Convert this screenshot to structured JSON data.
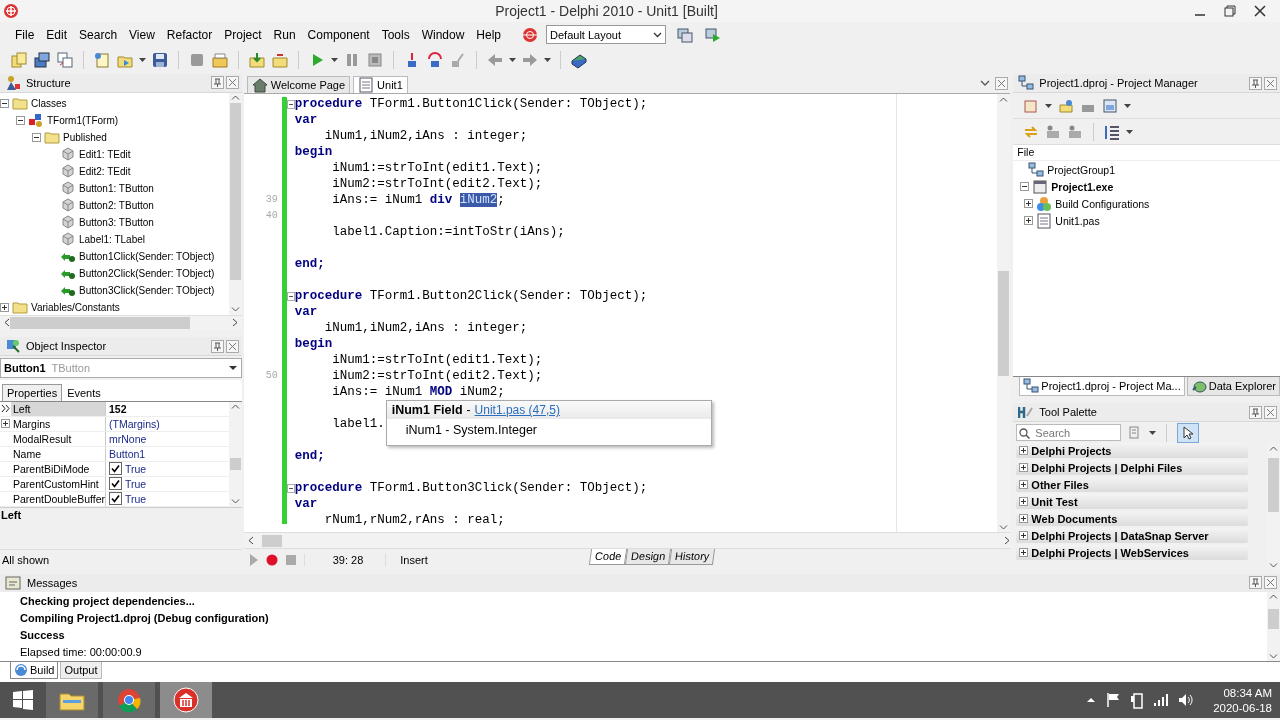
{
  "window": {
    "title": "Project1 - Delphi 2010 - Unit1 [Built]"
  },
  "menu": [
    "File",
    "Edit",
    "Search",
    "View",
    "Refactor",
    "Project",
    "Run",
    "Component",
    "Tools",
    "Window",
    "Help"
  ],
  "layout_select": {
    "value": "Default Layout"
  },
  "structure": {
    "title": "Structure",
    "tree": [
      {
        "label": "Classes",
        "kind": "folder",
        "expanded": true,
        "children": [
          {
            "label": "TForm1(TForm)",
            "kind": "class",
            "expanded": true,
            "children": [
              {
                "label": "Published",
                "kind": "folder",
                "expanded": true,
                "children": [
                  {
                    "label": "Edit1: TEdit",
                    "kind": "component"
                  },
                  {
                    "label": "Edit2: TEdit",
                    "kind": "component"
                  },
                  {
                    "label": "Button1: TButton",
                    "kind": "component"
                  },
                  {
                    "label": "Button2: TButton",
                    "kind": "component"
                  },
                  {
                    "label": "Button3: TButton",
                    "kind": "component"
                  },
                  {
                    "label": "Label1: TLabel",
                    "kind": "component"
                  },
                  {
                    "label": "Button1Click(Sender: TObject)",
                    "kind": "method"
                  },
                  {
                    "label": "Button2Click(Sender: TObject)",
                    "kind": "method"
                  },
                  {
                    "label": "Button3Click(Sender: TObject)",
                    "kind": "method"
                  }
                ]
              }
            ]
          }
        ]
      },
      {
        "label": "Variables/Constants",
        "kind": "folder",
        "expanded": false
      }
    ]
  },
  "object_inspector": {
    "title": "Object Inspector",
    "object_name": "Button1",
    "object_type": "TButton",
    "tabs": [
      {
        "label": "Properties",
        "selected": true
      },
      {
        "label": "Events",
        "selected": false
      }
    ],
    "properties": [
      {
        "name": "Left",
        "value": "152",
        "kind": "number",
        "selected": true
      },
      {
        "name": "Margins",
        "value": "(TMargins)",
        "kind": "ref",
        "selected": false,
        "expanded": false
      },
      {
        "name": "ModalResult",
        "value": "mrNone",
        "kind": "ref",
        "selected": false
      },
      {
        "name": "Name",
        "value": "Button1",
        "kind": "ref",
        "selected": false
      },
      {
        "name": "ParentBiDiMode",
        "value": "True",
        "kind": "bool",
        "checked": true,
        "selected": false
      },
      {
        "name": "ParentCustomHint",
        "value": "True",
        "kind": "bool",
        "checked": true,
        "selected": false
      },
      {
        "name": "ParentDoubleBuffer",
        "value": "True",
        "kind": "bool",
        "checked": true,
        "selected": false
      }
    ],
    "description": "Left",
    "status": "All shown"
  },
  "editor": {
    "tabs": [
      {
        "label": "Welcome Page",
        "kind": "home",
        "selected": false
      },
      {
        "label": "Unit1",
        "kind": "unit",
        "selected": true
      }
    ],
    "lines": [
      {
        "kind": "head",
        "fold": true,
        "tokens": [
          {
            "text": "procedure",
            "kind": "keyword"
          },
          {
            "text": " TForm1.Button1Click(Sender: TObject);",
            "kind": "plain"
          }
        ]
      },
      {
        "kind": "head",
        "fold": false,
        "tokens": [
          {
            "text": "var",
            "kind": "keyword"
          }
        ]
      },
      {
        "kind": "vars",
        "tokens": [
          {
            "text": "iNum1,iNum2,iAns : integer;",
            "kind": "plain"
          }
        ]
      },
      {
        "kind": "head",
        "fold": false,
        "tokens": [
          {
            "text": "begin",
            "kind": "keyword"
          }
        ]
      },
      {
        "kind": "stmt",
        "tokens": [
          {
            "text": "iNum1:=strToInt(edit1.Text);",
            "kind": "plain"
          }
        ]
      },
      {
        "kind": "stmt",
        "tokens": [
          {
            "text": "iNum2:=strToInt(edit2.Text);",
            "kind": "plain"
          }
        ]
      },
      {
        "kind": "stmt",
        "number": "39",
        "tokens": [
          {
            "text": "iAns:= iNum1 ",
            "kind": "plain"
          },
          {
            "text": "div ",
            "kind": "keyword"
          },
          {
            "text": "iNum2",
            "kind": "selected"
          },
          {
            "text": ";",
            "kind": "plain"
          }
        ]
      },
      {
        "kind": "blank",
        "number": "40"
      },
      {
        "kind": "stmt",
        "tokens": [
          {
            "text": "label1.Caption:=intToStr(iAns);",
            "kind": "plain"
          }
        ]
      },
      {
        "kind": "blank"
      },
      {
        "kind": "head",
        "fold": false,
        "tokens": [
          {
            "text": "end;",
            "kind": "keyword"
          }
        ]
      },
      {
        "kind": "blank"
      },
      {
        "kind": "head",
        "fold": true,
        "tokens": [
          {
            "text": "procedure",
            "kind": "keyword"
          },
          {
            "text": " TForm1.Button2Click(Sender: TObject);",
            "kind": "plain"
          }
        ]
      },
      {
        "kind": "head",
        "fold": false,
        "tokens": [
          {
            "text": "var",
            "kind": "keyword"
          }
        ]
      },
      {
        "kind": "vars",
        "tokens": [
          {
            "text": "iNum1,iNum2,iAns : integer;",
            "kind": "plain"
          }
        ]
      },
      {
        "kind": "head",
        "fold": false,
        "tokens": [
          {
            "text": "begin",
            "kind": "keyword"
          }
        ]
      },
      {
        "kind": "stmt",
        "tokens": [
          {
            "text": "iNum1:=strToInt(edit1.Text);",
            "kind": "plain"
          }
        ]
      },
      {
        "kind": "stmt",
        "number": "50",
        "tokens": [
          {
            "text": "iNum2:=strToInt(edit2.Text);",
            "kind": "plain"
          }
        ]
      },
      {
        "kind": "stmt",
        "tokens": [
          {
            "text": "iAns:= iNum1 ",
            "kind": "plain"
          },
          {
            "text": "MOD",
            "kind": "keyword"
          },
          {
            "text": " iNum2;",
            "kind": "plain"
          }
        ]
      },
      {
        "kind": "blank"
      },
      {
        "kind": "stmt",
        "tokens": [
          {
            "text": "label1.",
            "kind": "plain"
          }
        ]
      },
      {
        "kind": "blank"
      },
      {
        "kind": "head",
        "fold": false,
        "tokens": [
          {
            "text": "end;",
            "kind": "keyword"
          }
        ]
      },
      {
        "kind": "blank"
      },
      {
        "kind": "head",
        "fold": true,
        "tokens": [
          {
            "text": "procedure",
            "kind": "keyword"
          },
          {
            "text": " TForm1.Button3Click(Sender: TObject);",
            "kind": "plain"
          }
        ]
      },
      {
        "kind": "head",
        "fold": false,
        "tokens": [
          {
            "text": "var",
            "kind": "keyword"
          }
        ]
      },
      {
        "kind": "vars",
        "tokens": [
          {
            "text": "rNum1,rNum2,rAns : real;",
            "kind": "plain"
          }
        ]
      }
    ],
    "hint": {
      "title": "iNum1 Field",
      "separator": "-",
      "link": "Unit1.pas (47,5)",
      "detail": "iNum1 - System.Integer"
    },
    "status": {
      "position": "39: 28",
      "mode": "Insert"
    },
    "view_tabs": [
      {
        "label": "Code",
        "selected": true
      },
      {
        "label": "Design",
        "selected": false
      },
      {
        "label": "History",
        "selected": false
      }
    ]
  },
  "project_manager": {
    "title": "Project1.dproj - Project Manager",
    "column": "File",
    "tree": [
      {
        "label": "ProjectGroup1",
        "kind": "group",
        "children": [
          {
            "label": "Project1.exe",
            "kind": "project",
            "expanded": true,
            "children": [
              {
                "label": "Build Configurations",
                "kind": "config",
                "expanded": false
              },
              {
                "label": "Unit1.pas",
                "kind": "unit",
                "expanded": false
              }
            ]
          }
        ]
      }
    ],
    "tabs": [
      {
        "label": "Project1.dproj - Project Ma...",
        "selected": true
      },
      {
        "label": "Data Explorer",
        "selected": false
      }
    ]
  },
  "tool_palette": {
    "title": "Tool Palette",
    "search": {
      "placeholder": "Search"
    },
    "categories": [
      "Delphi Projects",
      "Delphi Projects | Delphi Files",
      "Other Files",
      "Unit Test",
      "Web Documents",
      "Delphi Projects | DataSnap Server",
      "Delphi Projects | WebServices"
    ]
  },
  "messages": {
    "title": "Messages",
    "lines": [
      {
        "text": "Checking project dependencies...",
        "kind": "step"
      },
      {
        "text": "Compiling Project1.dproj (Debug configuration)",
        "kind": "step"
      },
      {
        "text": "Success",
        "kind": "step"
      },
      {
        "text": "Elapsed time: 00:00:00.9",
        "kind": "info"
      }
    ],
    "tabs": [
      {
        "label": "Build",
        "selected": true
      },
      {
        "label": "Output",
        "selected": false
      }
    ]
  },
  "taskbar": {
    "apps": [
      {
        "kind": "explorer",
        "selected": false
      },
      {
        "kind": "chrome",
        "selected": false
      },
      {
        "kind": "delphi",
        "selected": true
      }
    ],
    "clock": {
      "time": "08:34 AM",
      "date": "2020-06-18"
    }
  }
}
